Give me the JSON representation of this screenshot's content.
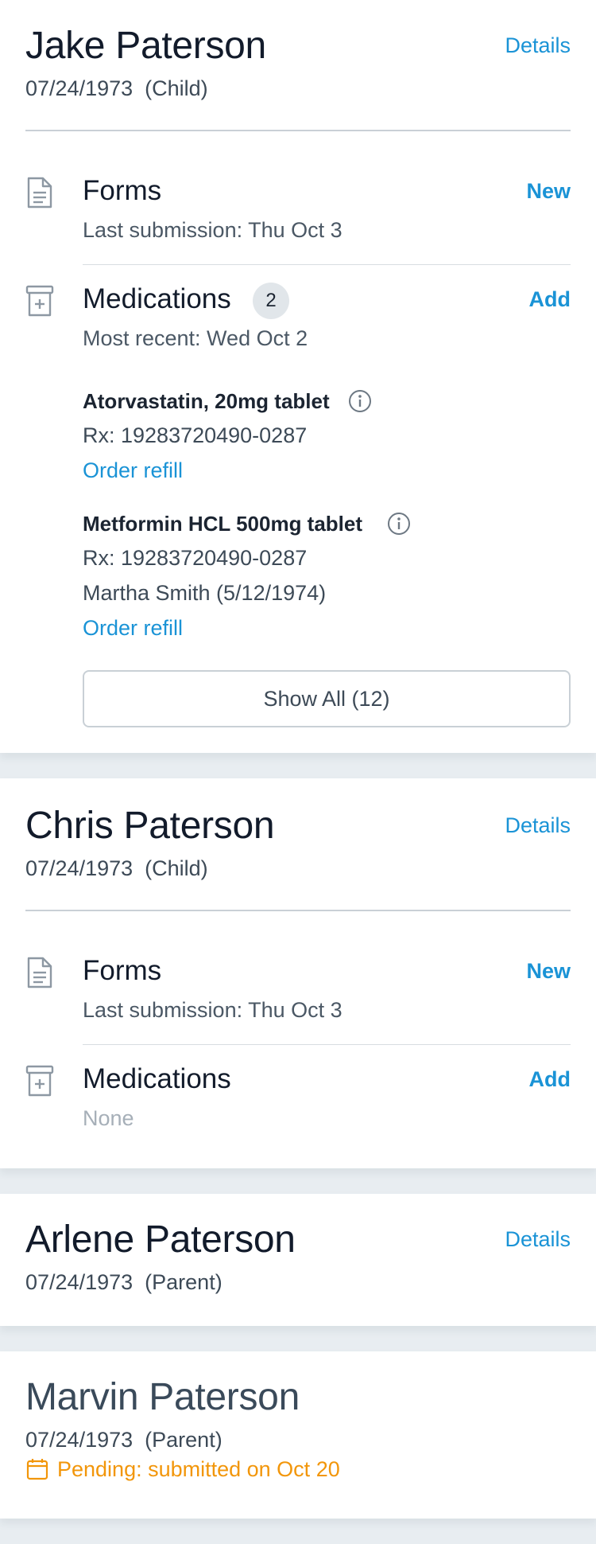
{
  "people": [
    {
      "name": "Jake Paterson",
      "dob": "07/24/1973",
      "relation": "(Child)",
      "details_label": "Details",
      "forms": {
        "title": "Forms",
        "subtitle": "Last submission: Thu Oct 3",
        "action": "New"
      },
      "medications": {
        "title": "Medications",
        "count": "2",
        "subtitle": "Most recent: Wed Oct 2",
        "action": "Add",
        "items": [
          {
            "name": "Atorvastatin, 20mg tablet",
            "rx": "Rx: 19283720490-0287",
            "refill": "Order refill"
          },
          {
            "name": "Metformin HCL 500mg tablet",
            "rx": "Rx: 19283720490-0287",
            "prescriber": "Martha Smith (5/12/1974)",
            "refill": "Order refill"
          }
        ],
        "show_all": "Show All (12)"
      }
    },
    {
      "name": "Chris Paterson",
      "dob": "07/24/1973",
      "relation": "(Child)",
      "details_label": "Details",
      "forms": {
        "title": "Forms",
        "subtitle": "Last submission: Thu Oct 3",
        "action": "New"
      },
      "medications": {
        "title": "Medications",
        "subtitle": "None",
        "action": "Add"
      }
    },
    {
      "name": "Arlene Paterson",
      "dob": "07/24/1973",
      "relation": "(Parent)",
      "details_label": "Details"
    },
    {
      "name": "Marvin Paterson",
      "dob": "07/24/1973",
      "relation": "(Parent)",
      "pending": "Pending: submitted on Oct 20"
    }
  ],
  "icons": {
    "forms": "document-icon",
    "medications": "pill-box-icon",
    "info": "info-icon",
    "pending": "calendar-icon"
  },
  "colors": {
    "accent": "#1a93d6",
    "pending": "#f2960a",
    "background": "#e8edf1"
  }
}
